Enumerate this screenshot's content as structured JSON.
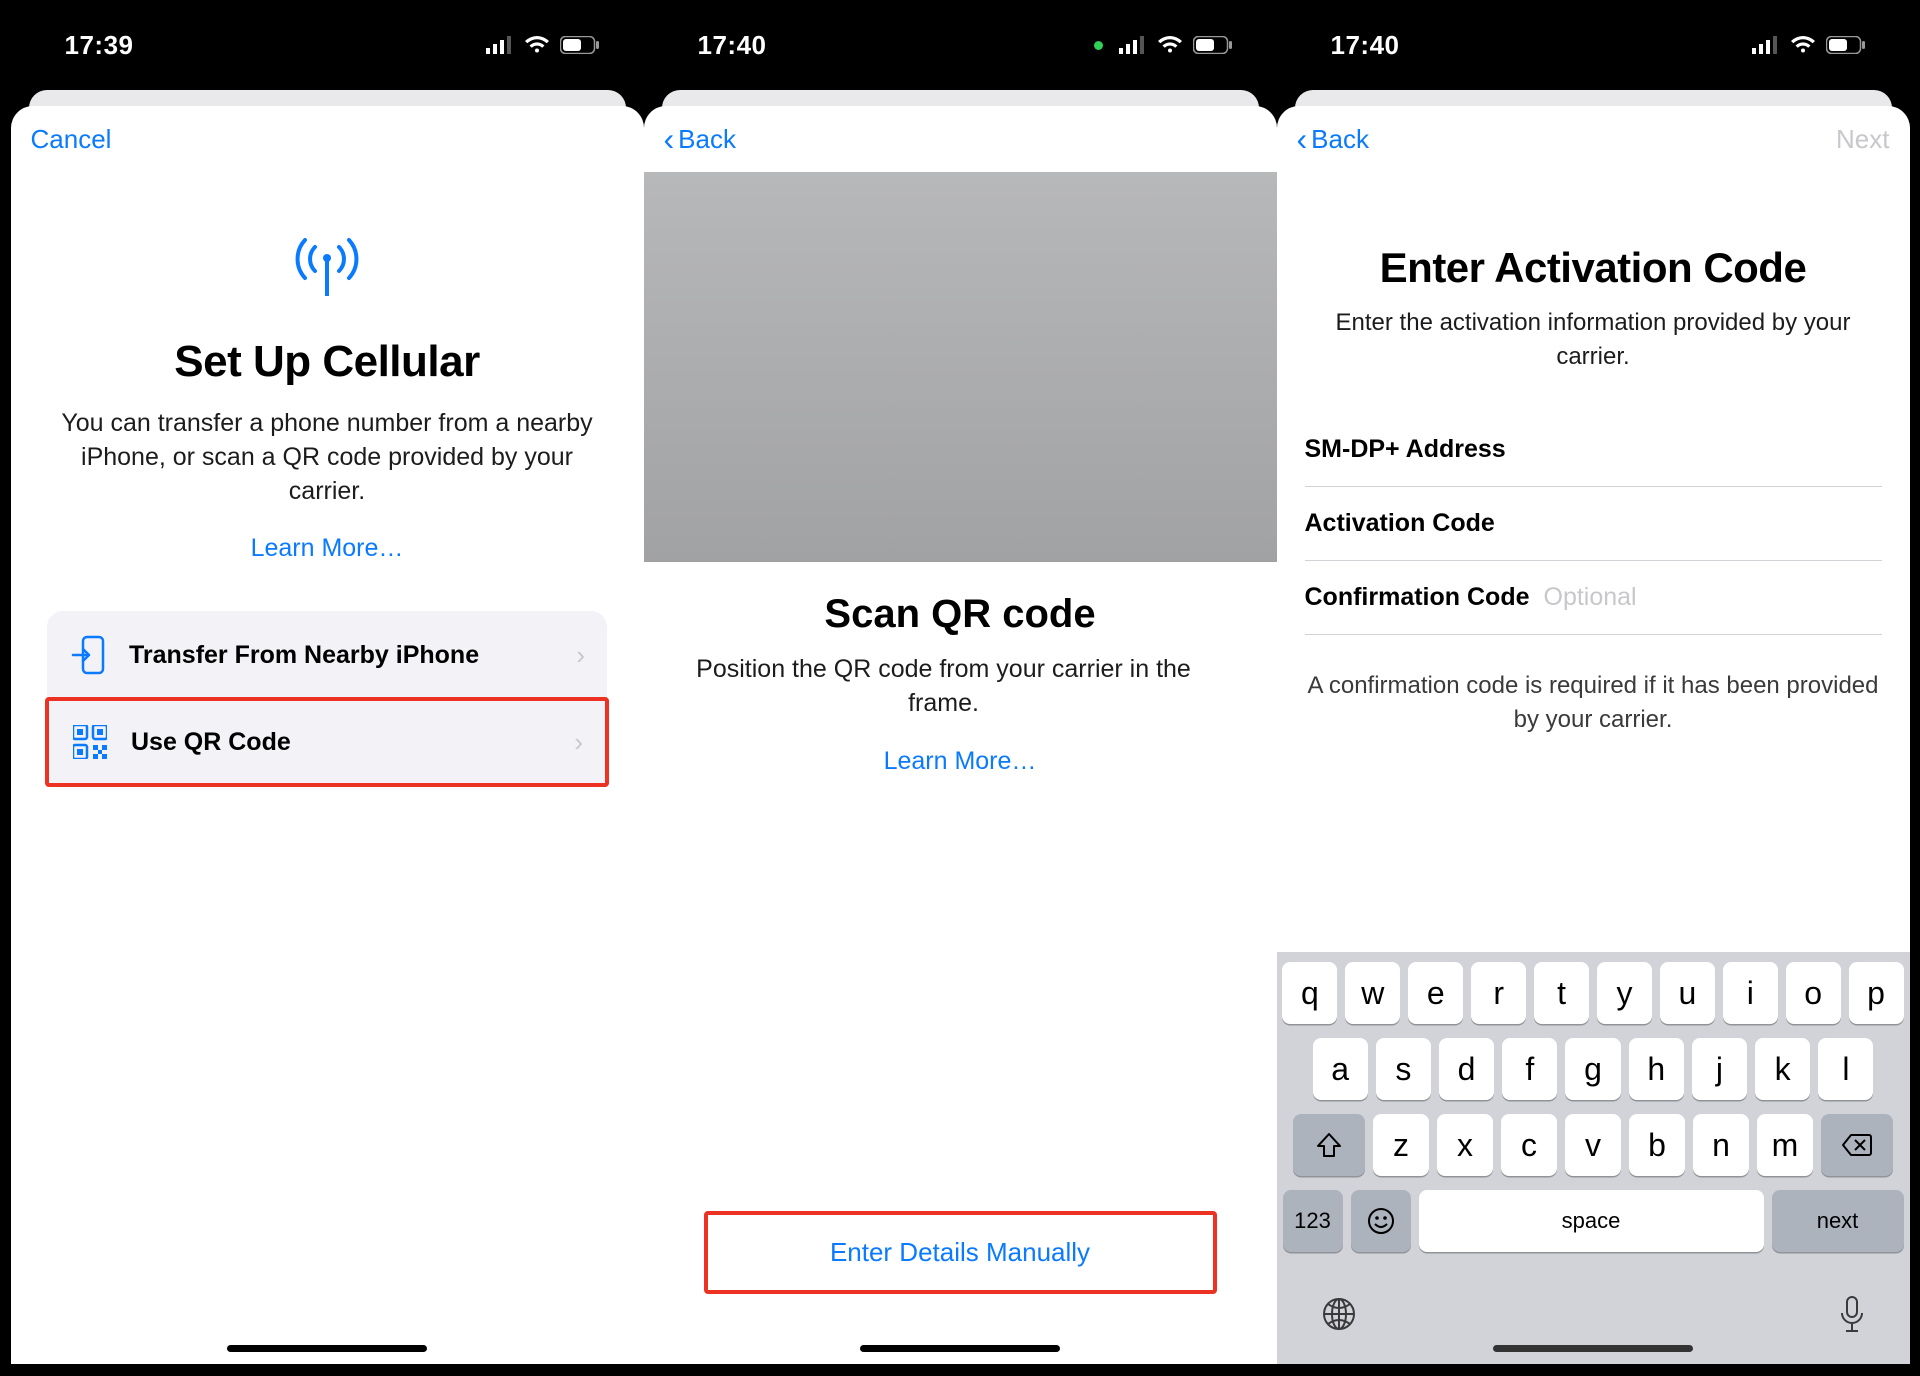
{
  "screens": [
    {
      "time": "17:39",
      "nav_left": "Cancel",
      "title": "Set Up Cellular",
      "body": "You can transfer a phone number from a nearby iPhone, or scan a QR code provided by your carrier.",
      "learn_more": "Learn More…",
      "options": [
        {
          "label": "Transfer From Nearby iPhone",
          "highlighted": false
        },
        {
          "label": "Use QR Code",
          "highlighted": true
        }
      ]
    },
    {
      "time": "17:40",
      "nav_left": "Back",
      "title": "Scan QR code",
      "body": "Position the QR code from your carrier in the frame.",
      "learn_more": "Learn More…",
      "manual_link": "Enter Details Manually"
    },
    {
      "time": "17:40",
      "nav_left": "Back",
      "nav_right": "Next",
      "title": "Enter Activation Code",
      "subtitle": "Enter the activation information provided by your carrier.",
      "fields": [
        {
          "label": "SM-DP+ Address",
          "optional": ""
        },
        {
          "label": "Activation Code",
          "optional": ""
        },
        {
          "label": "Confirmation Code",
          "optional": "Optional"
        }
      ],
      "helper": "A confirmation code is required if it has been provided by your carrier.",
      "keyboard": {
        "row1": [
          "q",
          "w",
          "e",
          "r",
          "t",
          "y",
          "u",
          "i",
          "o",
          "p"
        ],
        "row2": [
          "a",
          "s",
          "d",
          "f",
          "g",
          "h",
          "j",
          "k",
          "l"
        ],
        "row3": [
          "z",
          "x",
          "c",
          "v",
          "b",
          "n",
          "m"
        ],
        "num": "123",
        "space": "space",
        "next": "next"
      }
    }
  ]
}
